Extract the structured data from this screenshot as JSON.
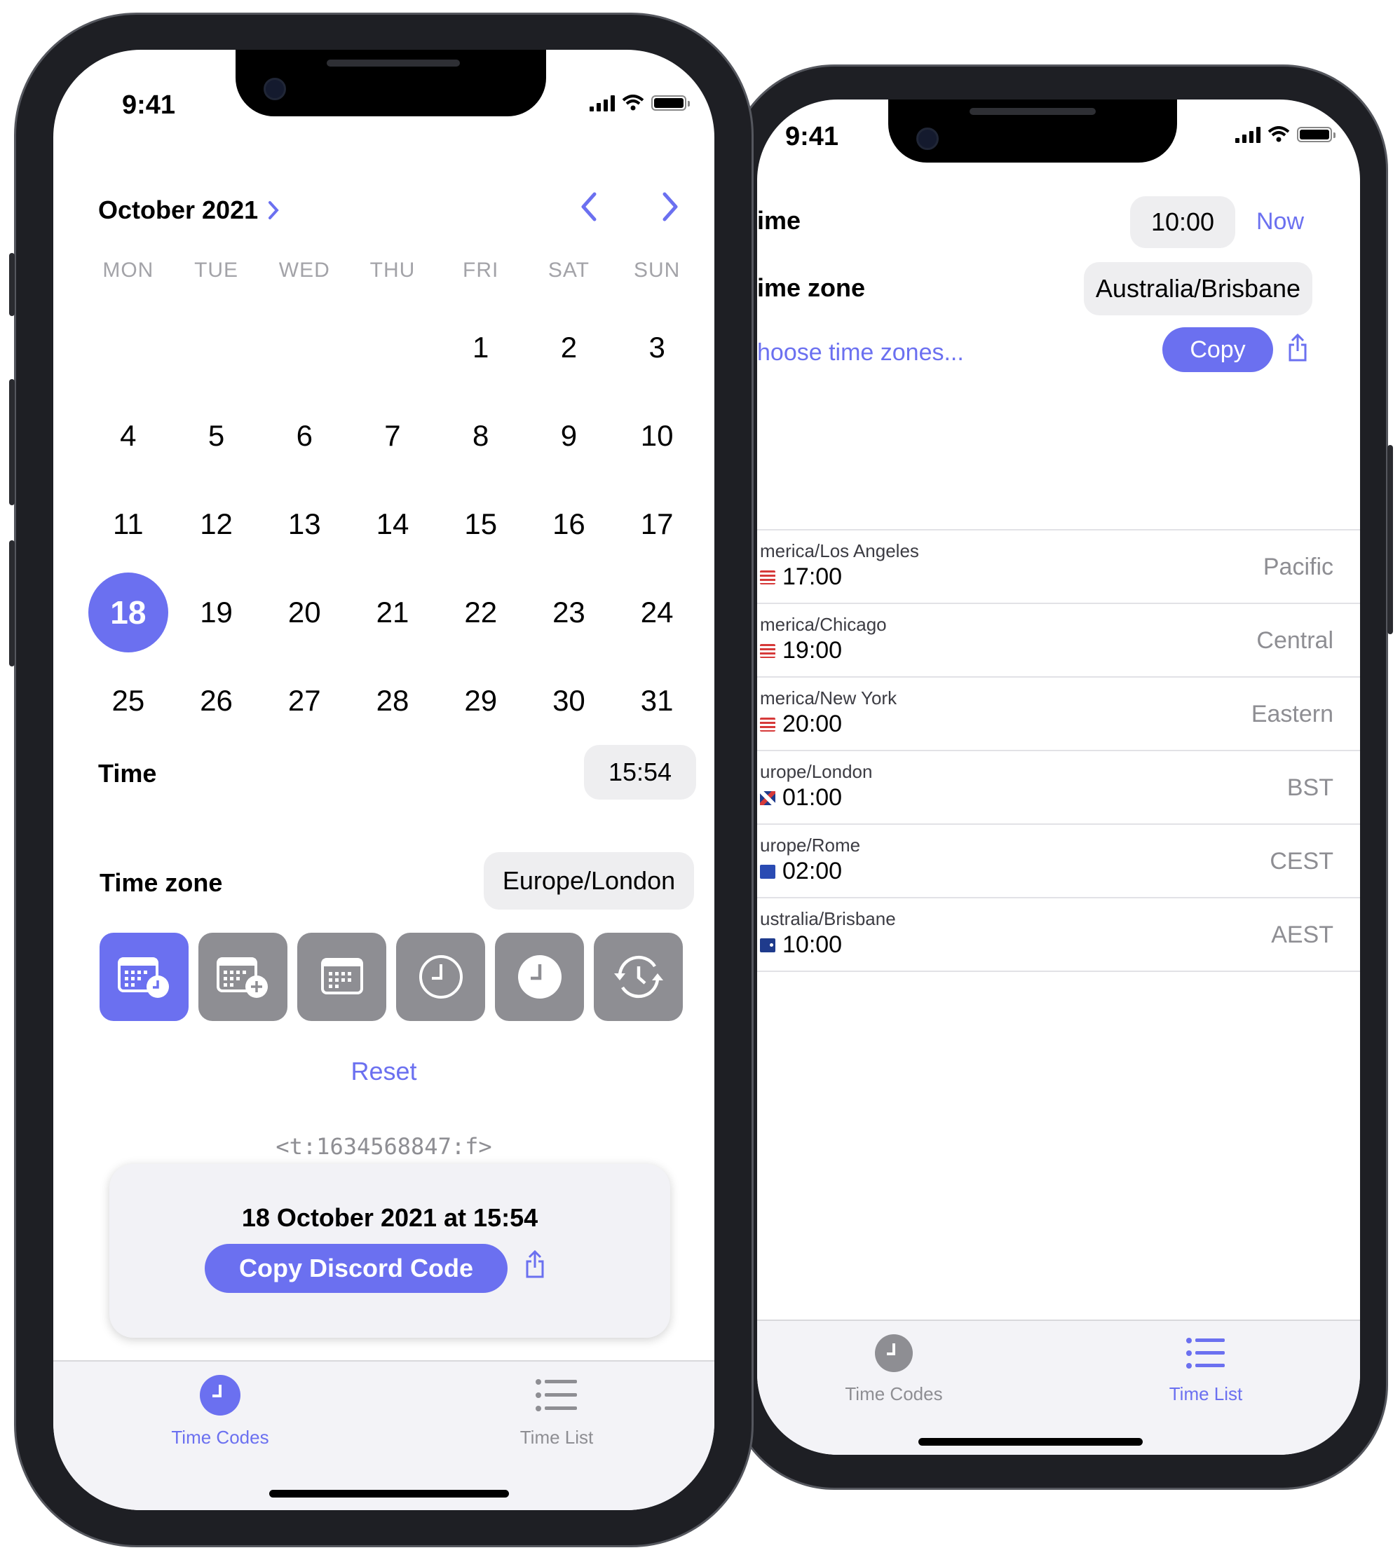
{
  "colors": {
    "accent": "#6b70f0",
    "pill_bg": "#eeeef0",
    "tab_inactive": "#8e8e93",
    "muted": "#a3a3a8"
  },
  "front": {
    "status": {
      "time": "9:41"
    },
    "calendar": {
      "month_label": "October 2021",
      "weekdays": [
        "MON",
        "TUE",
        "WED",
        "THU",
        "FRI",
        "SAT",
        "SUN"
      ],
      "days": [
        "",
        "",
        "",
        "",
        "1",
        "2",
        "3",
        "4",
        "5",
        "6",
        "7",
        "8",
        "9",
        "10",
        "11",
        "12",
        "13",
        "14",
        "15",
        "16",
        "17",
        "18",
        "19",
        "20",
        "21",
        "22",
        "23",
        "24",
        "25",
        "26",
        "27",
        "28",
        "29",
        "30",
        "31"
      ],
      "selected_day": "18"
    },
    "time": {
      "label": "Time",
      "value": "15:54"
    },
    "timezone": {
      "label": "Time zone",
      "value": "Europe/London"
    },
    "formats": [
      "calendar-clock-icon",
      "calendar-plus-icon",
      "calendar-icon",
      "clock-outline-icon",
      "clock-filled-icon",
      "clock-history-icon"
    ],
    "reset_label": "Reset",
    "code": "<t:1634568847:f>",
    "card": {
      "title": "18 October 2021 at 15:54",
      "copy_label": "Copy Discord Code"
    },
    "tabs": [
      {
        "label": "Time Codes",
        "icon": "clock-icon",
        "active": true
      },
      {
        "label": "Time List",
        "icon": "list-icon",
        "active": false
      }
    ]
  },
  "back": {
    "status": {
      "time": "9:41"
    },
    "time": {
      "label": "ime",
      "value": "10:00",
      "now_label": "Now"
    },
    "timezone": {
      "label": "ime zone",
      "value": "Australia/Brisbane"
    },
    "choose_label": "hoose time zones...",
    "copy_label": "Copy",
    "zones": [
      {
        "name": "merica/Los Angeles",
        "time": "17:00",
        "abbr": "Pacific",
        "flag": "us"
      },
      {
        "name": "merica/Chicago",
        "time": "19:00",
        "abbr": "Central",
        "flag": "us"
      },
      {
        "name": "merica/New York",
        "time": "20:00",
        "abbr": "Eastern",
        "flag": "us"
      },
      {
        "name": "urope/London",
        "time": "01:00",
        "abbr": "BST",
        "flag": "uk"
      },
      {
        "name": "urope/Rome",
        "time": "02:00",
        "abbr": "CEST",
        "flag": "eu"
      },
      {
        "name": "ustralia/Brisbane",
        "time": "10:00",
        "abbr": "AEST",
        "flag": "au"
      }
    ],
    "tabs": [
      {
        "label": "Time Codes",
        "icon": "clock-icon",
        "active": false
      },
      {
        "label": "Time List",
        "icon": "list-icon",
        "active": true
      }
    ]
  }
}
